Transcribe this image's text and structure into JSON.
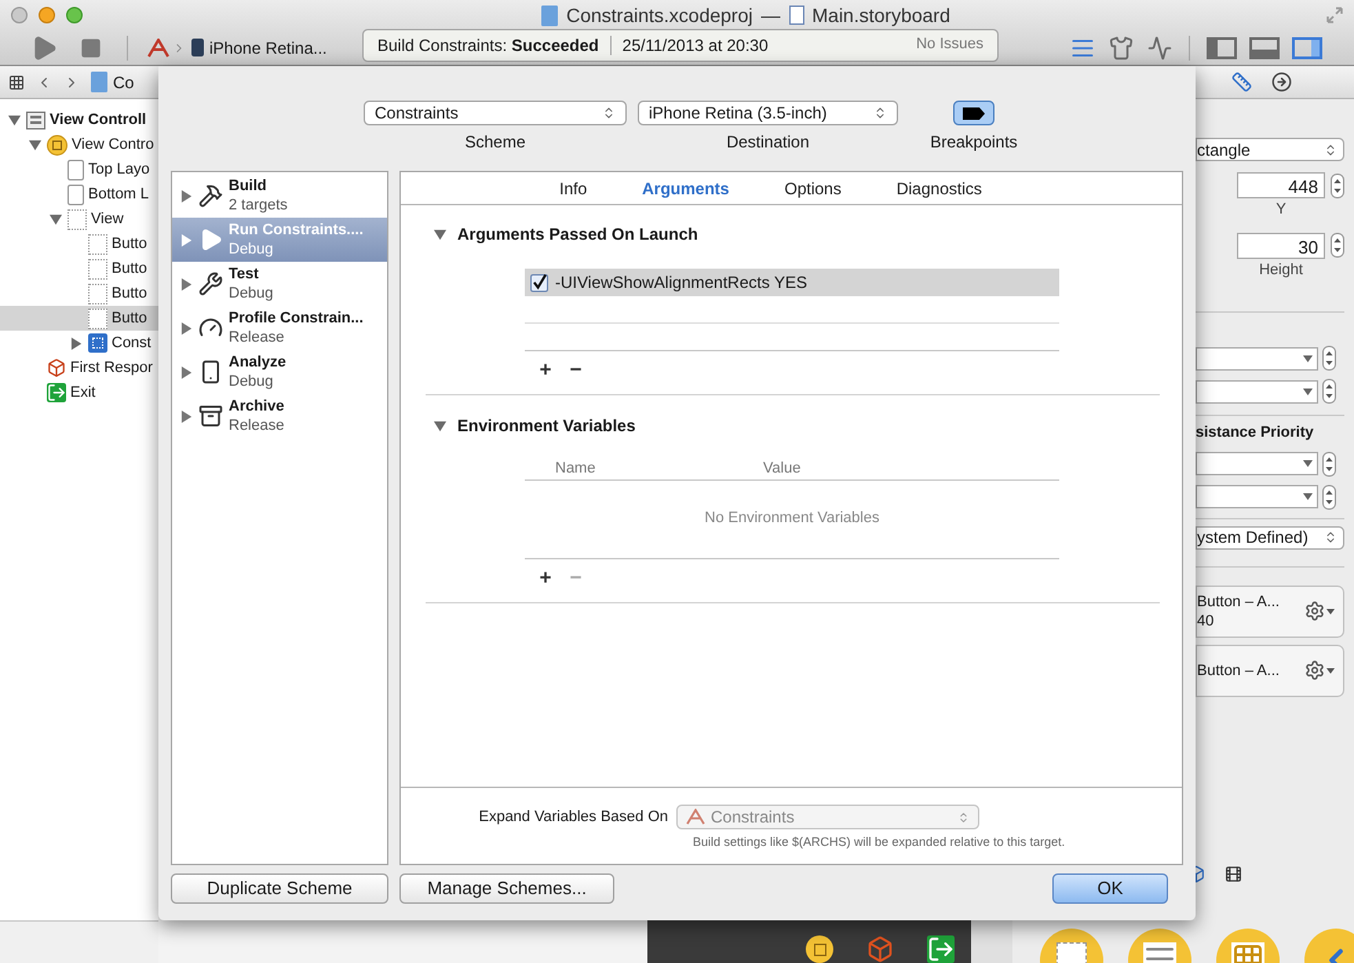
{
  "window": {
    "project": "Constraints.xcodeproj",
    "separator": "—",
    "file": "Main.storyboard"
  },
  "toolbar": {
    "destination": "iPhone Retina...",
    "status": "Build Constraints: **Succeeded**",
    "time": "25/11/2013 at 20:30",
    "issues": "No Issues",
    "editor_modes": [
      {
        "kind": "standard",
        "selected": true
      },
      {
        "kind": "assistant",
        "selected": false
      },
      {
        "kind": "version",
        "selected": false
      }
    ],
    "panels": [
      {
        "kind": "left",
        "selected": false
      },
      {
        "kind": "bottom",
        "selected": false
      },
      {
        "kind": "right",
        "selected": true
      }
    ]
  },
  "jump_bar": {
    "path": "Co"
  },
  "navigator": [
    {
      "label": "View Controll",
      "kind": "scene",
      "expanded": true,
      "selected": false,
      "children": [
        {
          "label": "View Contro",
          "kind": "controller",
          "expanded": true,
          "selected": false,
          "children": [
            {
              "label": "Top Layo",
              "kind": "guide",
              "selected": false
            },
            {
              "label": "Bottom L",
              "kind": "guide",
              "selected": false
            },
            {
              "label": "View",
              "kind": "view",
              "expanded": true,
              "selected": false,
              "children": [
                {
                  "label": "Butto",
                  "kind": "view",
                  "selected": false
                },
                {
                  "label": "Butto",
                  "kind": "view",
                  "selected": false
                },
                {
                  "label": "Butto",
                  "kind": "view",
                  "selected": false
                },
                {
                  "label": "Butto",
                  "kind": "view",
                  "selected": true
                },
                {
                  "label": "Const",
                  "kind": "constraints",
                  "expanded": false,
                  "selected": false
                }
              ]
            }
          ]
        },
        {
          "label": "First Respor",
          "kind": "responder",
          "selected": false
        },
        {
          "label": "Exit",
          "kind": "exit",
          "selected": false
        }
      ]
    }
  ],
  "inspector": {
    "tabs": [
      {
        "kind": "size",
        "selected": true
      },
      {
        "kind": "connections",
        "selected": false
      }
    ],
    "arrange": "ctangle",
    "fields": [
      {
        "value": "448",
        "label": "Y"
      },
      {
        "value": "30",
        "label": "Height"
      }
    ],
    "priority_heading": "sistance Priority",
    "placeholder": "ystem Defined)",
    "constraints": [
      {
        "text": "Button – A...",
        "detail": "40"
      },
      {
        "text": "Button – A..."
      }
    ]
  },
  "sheet": {
    "scheme": {
      "value": "Constraints",
      "label": "Scheme"
    },
    "destination": {
      "value": "iPhone Retina (3.5-inch)",
      "label": "Destination"
    },
    "breakpoints": {
      "label": "Breakpoints",
      "on": true
    },
    "actions": [
      {
        "kind": "build",
        "name": "Build",
        "detail": "2 targets",
        "selected": false
      },
      {
        "kind": "run",
        "name": "Run Constraints....",
        "detail": "Debug",
        "selected": true
      },
      {
        "kind": "test",
        "name": "Test",
        "detail": "Debug",
        "selected": false
      },
      {
        "kind": "profile",
        "name": "Profile Constrain...",
        "detail": "Release",
        "selected": false
      },
      {
        "kind": "analyze",
        "name": "Analyze",
        "detail": "Debug",
        "selected": false
      },
      {
        "kind": "archive",
        "name": "Archive",
        "detail": "Release",
        "selected": false
      }
    ],
    "tabs": [
      {
        "label": "Info",
        "selected": false
      },
      {
        "label": "Arguments",
        "selected": true
      },
      {
        "label": "Options",
        "selected": false
      },
      {
        "label": "Diagnostics",
        "selected": false
      }
    ],
    "arguments": {
      "title": "Arguments Passed On Launch",
      "expanded": true,
      "rows": [
        {
          "text": "-UIViewShowAlignmentRects YES",
          "checked": true,
          "selected": true
        }
      ],
      "add": {
        "label": "+",
        "disabled": false
      },
      "remove": {
        "label": "−",
        "disabled": false
      }
    },
    "environment": {
      "title": "Environment Variables",
      "expanded": true,
      "columns": [
        "Name",
        "Value"
      ],
      "empty": "No Environment Variables",
      "add": {
        "label": "+",
        "disabled": false
      },
      "remove": {
        "label": "−",
        "disabled": true
      }
    },
    "expand": {
      "label": "Expand Variables Based On",
      "value": "Constraints",
      "disabled": true,
      "note": "Build settings like $(ARCHS) will be expanded relative to this target."
    },
    "buttons": [
      {
        "label": "Duplicate Scheme",
        "default": false
      },
      {
        "label": "Manage Schemes...",
        "default": false
      },
      {
        "label": "OK",
        "default": true
      }
    ]
  }
}
